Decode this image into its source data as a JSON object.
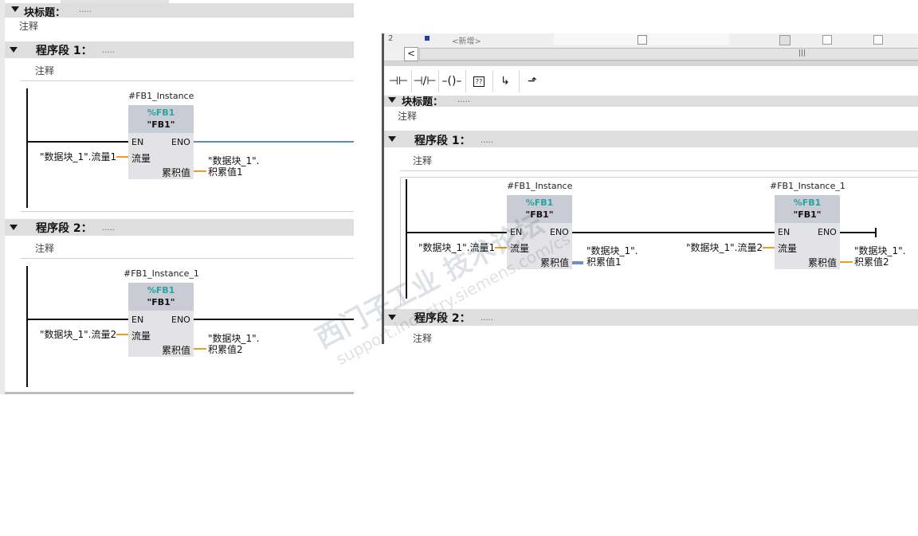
{
  "left": {
    "block_title": "块标题：",
    "block_dots": ".....",
    "block_comment": "注释",
    "networks": [
      {
        "title": "程序段 1：",
        "dots": ".....",
        "comment": "注释",
        "instance": "#FB1_Instance",
        "fb_pct": "%FB1",
        "fb_name": "\"FB1\"",
        "en": "EN",
        "eno": "ENO",
        "in_pin": "流量",
        "out_pin": "累积值",
        "in_param": "\"数据块_1\".流量1",
        "out_param_1": "\"数据块_1\".",
        "out_param_2": "积累值1"
      },
      {
        "title": "程序段 2：",
        "dots": ".....",
        "comment": "注释",
        "instance": "#FB1_Instance_1",
        "fb_pct": "%FB1",
        "fb_name": "\"FB1\"",
        "en": "EN",
        "eno": "ENO",
        "in_pin": "流量",
        "out_pin": "累积值",
        "in_param": "\"数据块_1\".流量2",
        "out_param_1": "\"数据块_1\".",
        "out_param_2": "积累值2"
      }
    ]
  },
  "right": {
    "table_row": {
      "index": "2",
      "new_placeholder": "<新增>"
    },
    "toolbar": [
      {
        "name": "no-contact",
        "glyph": "⊣⊢"
      },
      {
        "name": "nc-contact",
        "glyph": "⊣/⊢"
      },
      {
        "name": "coil",
        "glyph": "–()–"
      },
      {
        "name": "empty-box",
        "glyph": "[??]"
      },
      {
        "name": "open-branch",
        "glyph": "↳"
      },
      {
        "name": "close-branch",
        "glyph": "⬏"
      }
    ],
    "block_title": "块标题：",
    "block_dots": ".....",
    "block_comment": "注释",
    "network1": {
      "title": "程序段 1：",
      "dots": ".....",
      "comment": "注释",
      "blocks": [
        {
          "instance": "#FB1_Instance",
          "fb_pct": "%FB1",
          "fb_name": "\"FB1\"",
          "en": "EN",
          "eno": "ENO",
          "in_pin": "流量",
          "out_pin": "累积值",
          "in_param": "\"数据块_1\".流量1",
          "out_param_1": "\"数据块_1\".",
          "out_param_2": "积累值1"
        },
        {
          "instance": "#FB1_Instance_1",
          "fb_pct": "%FB1",
          "fb_name": "\"FB1\"",
          "en": "EN",
          "eno": "ENO",
          "in_pin": "流量",
          "out_pin": "累积值",
          "in_param": "\"数据块_1\".流量2",
          "out_param_1": "\"数据块_1\".",
          "out_param_2": "积累值2"
        }
      ]
    },
    "network2": {
      "title": "程序段 2：",
      "dots": ".....",
      "comment": "注释"
    }
  },
  "watermark": {
    "line1": "西门子工业 技术论坛",
    "line2": "support.industry.siemens.com/cs"
  }
}
